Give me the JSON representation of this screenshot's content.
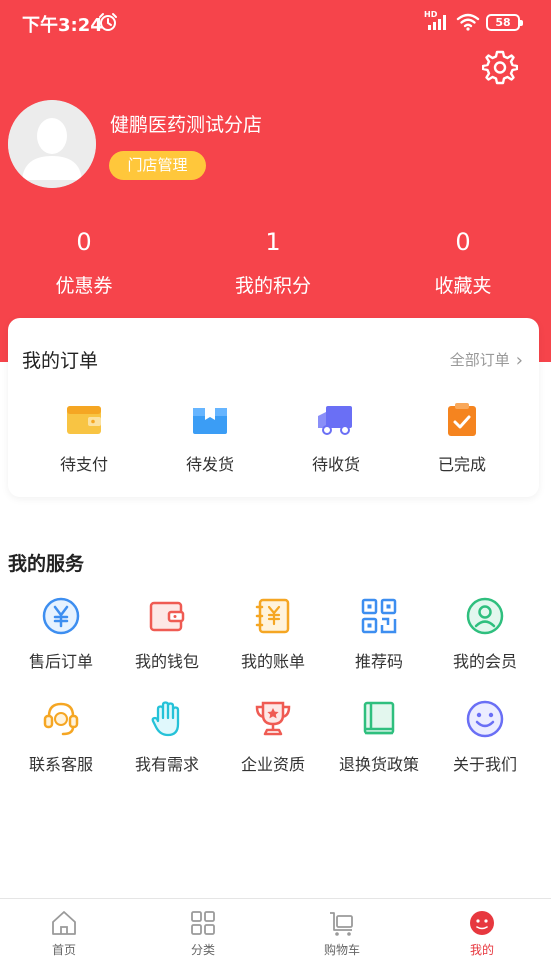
{
  "status_bar": {
    "time": "下午3:24",
    "network_label": "HD",
    "battery": "58"
  },
  "profile": {
    "store_name": "健鹏医药测试分店",
    "manage_label": "门店管理"
  },
  "stats": [
    {
      "value": "0",
      "label": "优惠券"
    },
    {
      "value": "1",
      "label": "我的积分"
    },
    {
      "value": "0",
      "label": "收藏夹"
    }
  ],
  "orders": {
    "title": "我的订单",
    "all_label": "全部订单",
    "items": [
      {
        "label": "待支付",
        "icon": "wallet-icon"
      },
      {
        "label": "待发货",
        "icon": "package-icon"
      },
      {
        "label": "待收货",
        "icon": "truck-icon"
      },
      {
        "label": "已完成",
        "icon": "clipboard-check-icon"
      }
    ]
  },
  "services": {
    "title": "我的服务",
    "items": [
      {
        "label": "售后订单",
        "icon": "yen-circle-icon"
      },
      {
        "label": "我的钱包",
        "icon": "wallet-icon"
      },
      {
        "label": "我的账单",
        "icon": "bill-icon"
      },
      {
        "label": "推荐码",
        "icon": "qr-code-icon"
      },
      {
        "label": "我的会员",
        "icon": "member-icon"
      },
      {
        "label": "联系客服",
        "icon": "headset-icon"
      },
      {
        "label": "我有需求",
        "icon": "hand-icon"
      },
      {
        "label": "企业资质",
        "icon": "trophy-icon"
      },
      {
        "label": "退换货政策",
        "icon": "book-icon"
      },
      {
        "label": "关于我们",
        "icon": "smile-icon"
      }
    ]
  },
  "tabbar": {
    "items": [
      {
        "label": "首页",
        "icon": "home-icon"
      },
      {
        "label": "分类",
        "icon": "grid-icon"
      },
      {
        "label": "购物车",
        "icon": "cart-icon"
      },
      {
        "label": "我的",
        "icon": "profile-icon"
      }
    ],
    "active_index": 3
  },
  "colors": {
    "header_red": "#f6444b",
    "badge_yellow": "#ffc73b",
    "active_tab": "#e7383f"
  }
}
